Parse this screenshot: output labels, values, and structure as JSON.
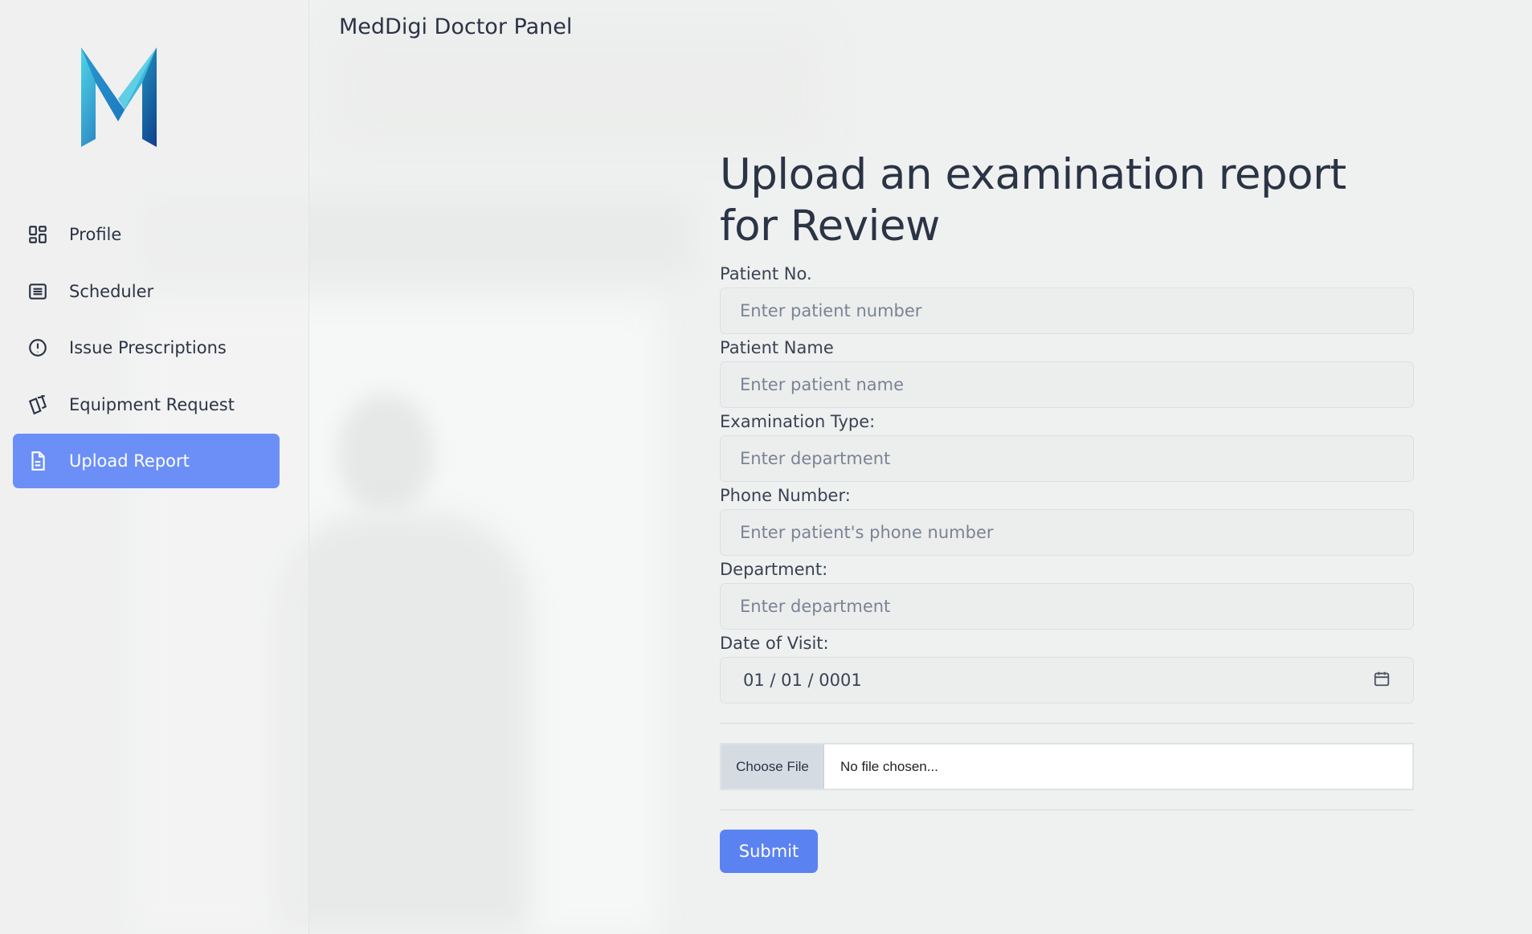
{
  "app": {
    "title": "MedDigi Doctor Panel"
  },
  "sidebar": {
    "logo_icon": "meddigi-m-logo",
    "items": [
      {
        "label": "Profile",
        "icon": "dashboard-grid-icon",
        "active": false
      },
      {
        "label": "Scheduler",
        "icon": "list-icon",
        "active": false
      },
      {
        "label": "Issue Prescriptions",
        "icon": "alert-circle-icon",
        "active": false
      },
      {
        "label": "Equipment Request",
        "icon": "cards-icon",
        "active": false
      },
      {
        "label": "Upload Report",
        "icon": "document-icon",
        "active": true
      }
    ],
    "active_color": "#6b8ff7"
  },
  "form": {
    "heading": "Upload an examination report for Review",
    "fields": [
      {
        "label": "Patient No.",
        "placeholder": "Enter patient number",
        "value": ""
      },
      {
        "label": "Patient Name",
        "placeholder": "Enter patient name",
        "value": ""
      },
      {
        "label": "Examination Type:",
        "placeholder": "Enter department",
        "value": ""
      },
      {
        "label": "Phone Number:",
        "placeholder": "Enter patient's phone number",
        "value": ""
      },
      {
        "label": "Department:",
        "placeholder": "Enter department",
        "value": ""
      }
    ],
    "date": {
      "label": "Date of Visit:",
      "value": "01 / 01 / 0001",
      "icon": "calendar-icon"
    },
    "file": {
      "button_label": "Choose File",
      "status": "No file chosen..."
    },
    "submit_label": "Submit",
    "accent_color": "#5b82f1"
  }
}
